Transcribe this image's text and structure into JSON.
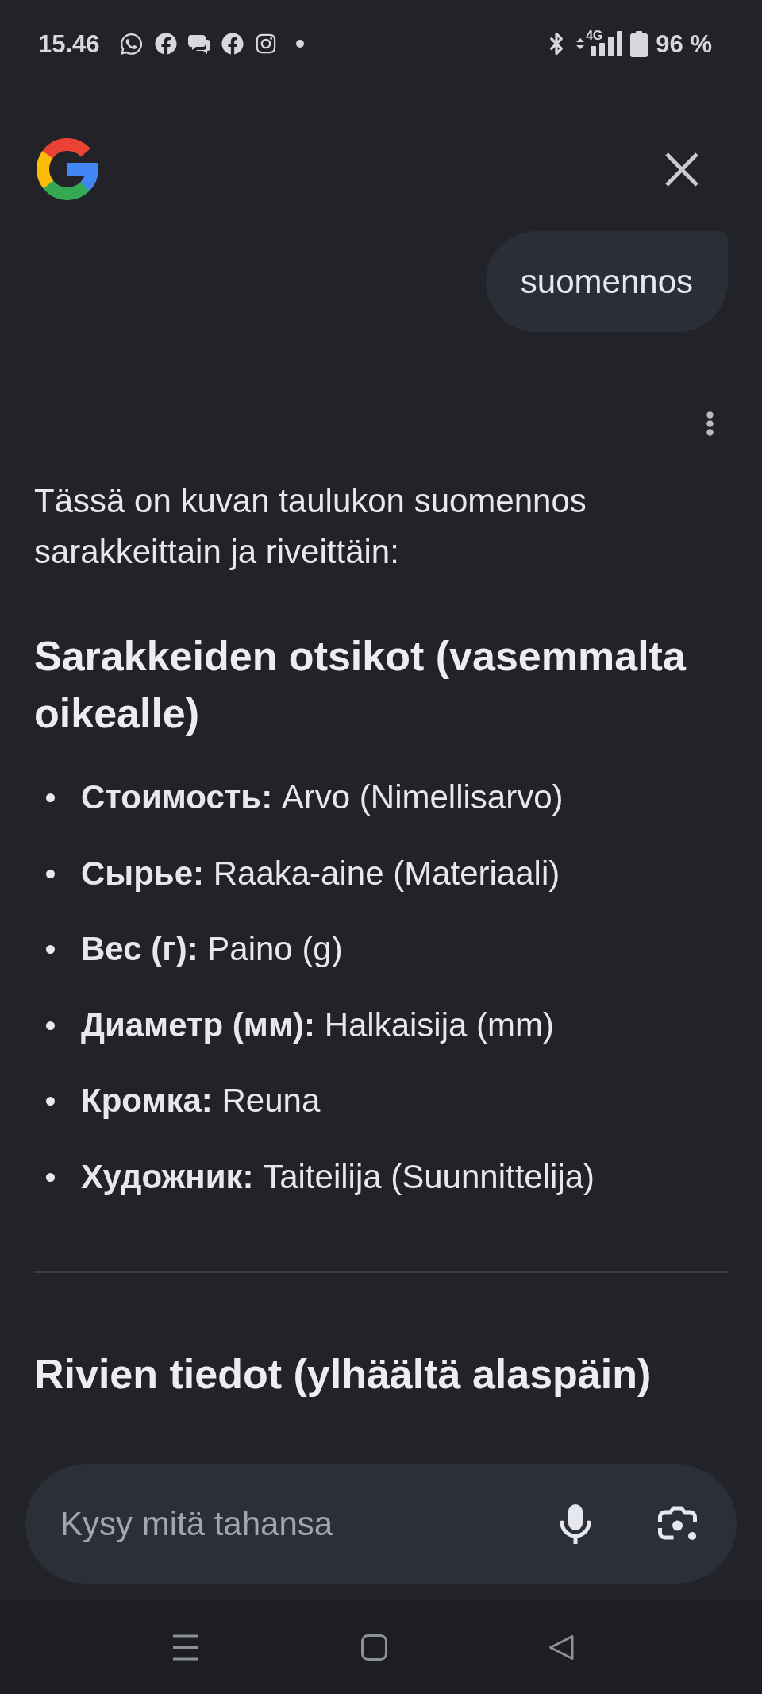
{
  "status_bar": {
    "time": "15.46",
    "network": "4G",
    "battery": "96 %"
  },
  "conversation": {
    "user_message": "suomennos",
    "response": {
      "intro": "Tässä on kuvan taulukon suomennos sarakkeittain ja riveittäin:",
      "sections": [
        {
          "heading": "Sarakkeiden otsikot (vasemmalta oikealle)",
          "bullets": [
            "**Стоимость:** Arvo (Nimellisarvo)",
            "**Сырье:** Raaka-aine (Materiaali)",
            "**Вес (г):** Paino (g)",
            "**Диаметр (мм):** Halkaisija (mm)",
            "**Кромка:** Reuna",
            "**Художник:** Taiteilija (Suunnittelija)"
          ]
        },
        {
          "heading": "Rivien tiedot (ylhäältä alaspäin)"
        }
      ]
    }
  },
  "prompt_bar": {
    "placeholder": "Kysy mitä tahansa"
  }
}
